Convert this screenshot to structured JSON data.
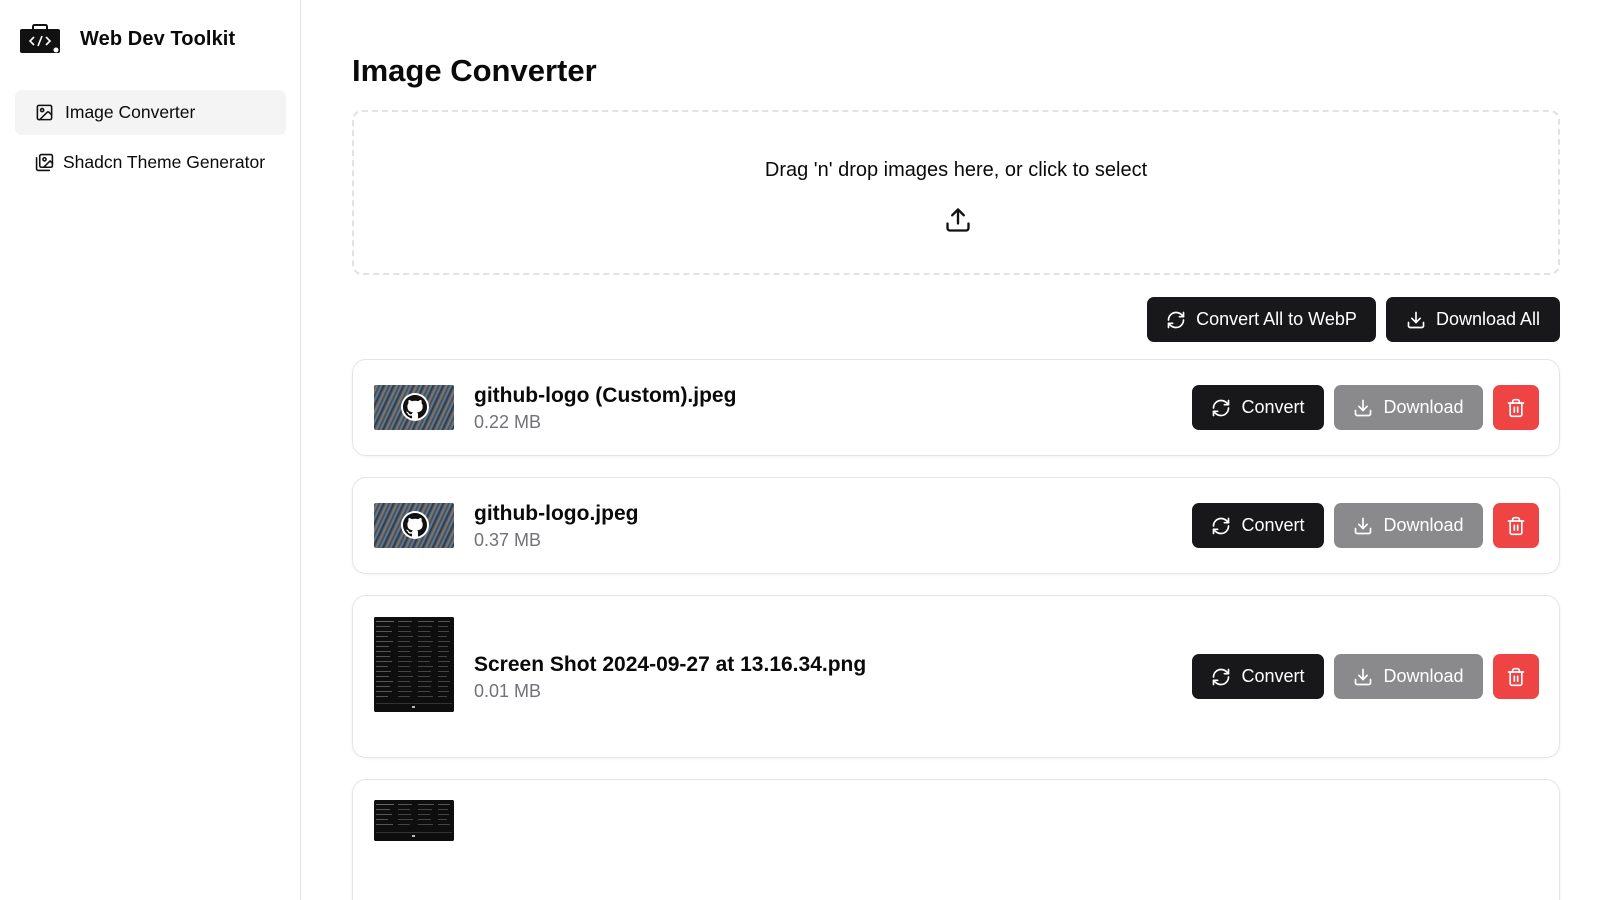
{
  "app": {
    "title": "Web Dev Toolkit"
  },
  "sidebar": {
    "items": [
      {
        "label": "Image Converter",
        "icon": "image-icon",
        "active": true
      },
      {
        "label": "Shadcn Theme Generator",
        "icon": "images-icon",
        "active": false
      }
    ]
  },
  "main": {
    "title": "Image Converter",
    "dropzone_text": "Drag 'n' drop images here, or click to select",
    "convert_all_label": "Convert All to WebP",
    "download_all_label": "Download All"
  },
  "files": [
    {
      "name": "github-logo (Custom).jpeg",
      "size": "0.22 MB",
      "convert_label": "Convert",
      "download_label": "Download"
    },
    {
      "name": "github-logo.jpeg",
      "size": "0.37 MB",
      "convert_label": "Convert",
      "download_label": "Download"
    },
    {
      "name": "Screen Shot 2024-09-27 at 13.16.34.png",
      "size": "0.01 MB",
      "convert_label": "Convert",
      "download_label": "Download"
    }
  ],
  "colors": {
    "primary": "#18181b",
    "muted_button": "#8a8a8d",
    "danger": "#ef4444",
    "active_nav_bg": "#f4f4f5",
    "secondary_text": "#71717a"
  }
}
